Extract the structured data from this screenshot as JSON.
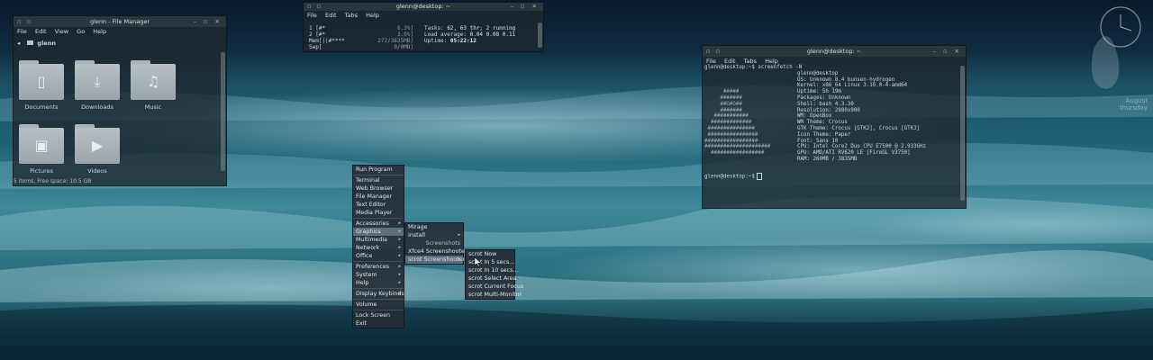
{
  "file_manager": {
    "title": "glenn - File Manager",
    "menu": [
      "File",
      "Edit",
      "View",
      "Go",
      "Help"
    ],
    "location": "glenn",
    "folders": [
      {
        "label": "Documents",
        "icon": "document-icon"
      },
      {
        "label": "Downloads",
        "icon": "download-icon"
      },
      {
        "label": "Music",
        "icon": "music-note-icon"
      },
      {
        "label": "Pictures",
        "icon": "picture-icon"
      },
      {
        "label": "Videos",
        "icon": "video-camera-icon"
      }
    ],
    "status": "5 items, Free space: 10.5 GB"
  },
  "htop": {
    "title": "glenn@desktop: ~",
    "menu": [
      "File",
      "Edit",
      "Tabs",
      "Help"
    ],
    "cpu1_label": "1  [#*",
    "cpu1_value": "6.3%]",
    "cpu2_label": "2  [#*",
    "cpu2_value": "3.0%]",
    "mem_label": "Mem[||#****",
    "mem_value": "272/3835MB]",
    "swp_label": "Swp[",
    "swp_value": "0/0MB]",
    "tasks_label": "Tasks:",
    "tasks_value": "62, 63 thr; 2 running",
    "load_label": "Load average:",
    "load_value": "0.04 0.08 0.11",
    "uptime_label": "Uptime:",
    "uptime_value": "05:22:12"
  },
  "terminal": {
    "title": "glenn@desktop: ~",
    "menu": [
      "File",
      "Edit",
      "Tabs",
      "Help"
    ],
    "command": "glenn@desktop:~$ screenfetch -N",
    "art": [
      "",
      "",
      "",
      "      #####",
      "     #######",
      "     ##O#O##",
      "     #######",
      "   ###########",
      "  #############",
      " ###############",
      " ################",
      "#################",
      "#####################",
      "  #################"
    ],
    "info": [
      "glenn@desktop",
      "OS: Unknown 8.4 bunsen-hydrogen",
      "Kernel: x86_64 Linux 3.16.0-4-amd64",
      "Uptime: 5h 19m",
      "Packages: Unknown",
      "Shell: bash 4.3.30",
      "Resolution: 2880x900",
      "WM: OpenBox",
      "WM Theme: Crocus",
      "GTK Theme: Crocus [GTK2], Crocus [GTK3]",
      "Icon Theme: Paper",
      "Font: Sans 10",
      "CPU: Intel Core2 Duo CPU E7500 @ 2.933GHz",
      "GPU: AMD/ATI RV620 LE [FireGL V3750]",
      "RAM: 260MB / 3835MB"
    ],
    "prompt": "glenn@desktop:~$"
  },
  "root_menu": {
    "items": [
      {
        "label": "Run Program",
        "submenu": false
      },
      {
        "separator": true
      },
      {
        "label": "Terminal",
        "submenu": false
      },
      {
        "label": "Web Browser",
        "submenu": false
      },
      {
        "label": "File Manager",
        "submenu": false
      },
      {
        "label": "Text Editor",
        "submenu": false
      },
      {
        "label": "Media Player",
        "submenu": false
      },
      {
        "separator": true
      },
      {
        "label": "Accessories",
        "submenu": true
      },
      {
        "label": "Graphics",
        "submenu": true,
        "selected": true
      },
      {
        "label": "Multimedia",
        "submenu": true
      },
      {
        "label": "Network",
        "submenu": true
      },
      {
        "label": "Office",
        "submenu": true
      },
      {
        "separator": true
      },
      {
        "label": "Preferences",
        "submenu": true
      },
      {
        "label": "System",
        "submenu": true
      },
      {
        "label": "Help",
        "submenu": true
      },
      {
        "separator": true
      },
      {
        "label": "Display Keybinds",
        "submenu": true
      },
      {
        "separator": true
      },
      {
        "label": "Volume",
        "submenu": false
      },
      {
        "separator": true
      },
      {
        "label": "Lock Screen",
        "submenu": false
      },
      {
        "label": "Exit",
        "submenu": false
      }
    ]
  },
  "graphics_menu": {
    "items": [
      {
        "label": "Mirage",
        "submenu": false
      },
      {
        "label": "Install",
        "submenu": true
      },
      {
        "header": "Screenshots"
      },
      {
        "label": "Xfce4 Screenshooter",
        "submenu": false
      },
      {
        "label": "scrot Screenshooter",
        "submenu": true,
        "selected": true
      }
    ]
  },
  "scrot_menu": {
    "items": [
      {
        "label": "scrot Now"
      },
      {
        "label": "scrot In 5 secs..."
      },
      {
        "label": "scrot In 10 secs..."
      },
      {
        "label": "scrot Select Area"
      },
      {
        "label": "scrot Current Focus"
      },
      {
        "label": "scrot Multi-Monitor"
      }
    ]
  },
  "conky": {
    "line1": "August",
    "line2": "thursday"
  },
  "colors": {
    "menu_bg": "#262e36",
    "menu_selected": "#6e8291",
    "window_bg": "#1e2830",
    "terminal_text": "#c9d6dc"
  }
}
